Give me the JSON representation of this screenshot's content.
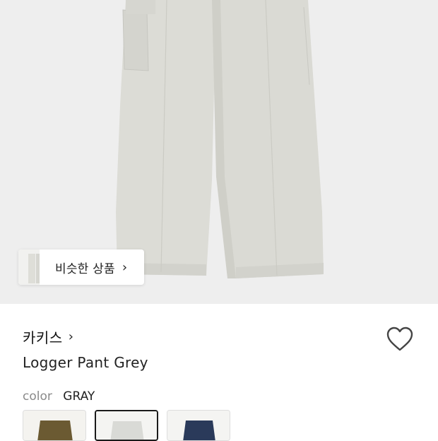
{
  "similar_button": {
    "label": "비슷한 상품"
  },
  "brand": {
    "name": "카키스"
  },
  "product": {
    "name": "Logger Pant Grey"
  },
  "color": {
    "label": "color",
    "value": "GRAY"
  },
  "swatches": [
    {
      "color": "#6b5a32",
      "selected": false
    },
    {
      "color": "#d9dad6",
      "selected": true
    },
    {
      "color": "#2a3a5a",
      "selected": false
    }
  ],
  "colors": {
    "background": "#eeeeee",
    "pants": "#dcdcd6",
    "text": "#1a1a1a",
    "muted": "#8a8a8a"
  }
}
